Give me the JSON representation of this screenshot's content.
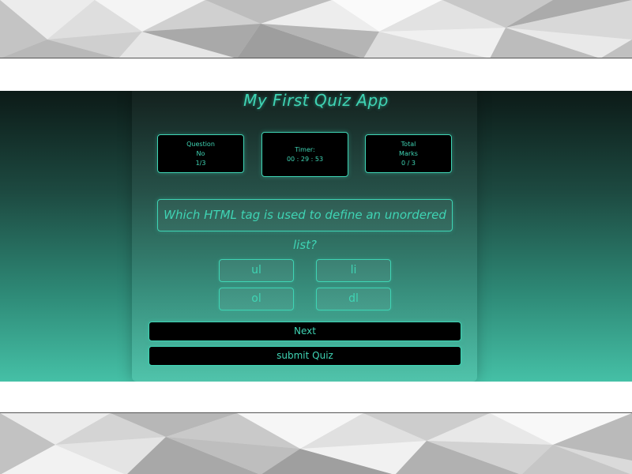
{
  "app": {
    "title": "My First Quiz App"
  },
  "stats": {
    "question": {
      "label_line1": "Question",
      "label_line2": "No",
      "value": "1/3"
    },
    "timer": {
      "label": "Timer:",
      "value": "00 : 29 : 53"
    },
    "marks": {
      "label_line1": "Total",
      "label_line2": "Marks",
      "value": "0 / 3"
    }
  },
  "question": {
    "text": "Which HTML tag is used to define an unordered list?"
  },
  "options": [
    "ul",
    "li",
    "ol",
    "dl"
  ],
  "buttons": {
    "next": "Next",
    "submit": "submit Quiz"
  },
  "colors": {
    "accent": "#3fd4b4",
    "box_bg": "#000000",
    "gradient_top": "#0c1a17",
    "gradient_bottom": "#45c0a6"
  }
}
